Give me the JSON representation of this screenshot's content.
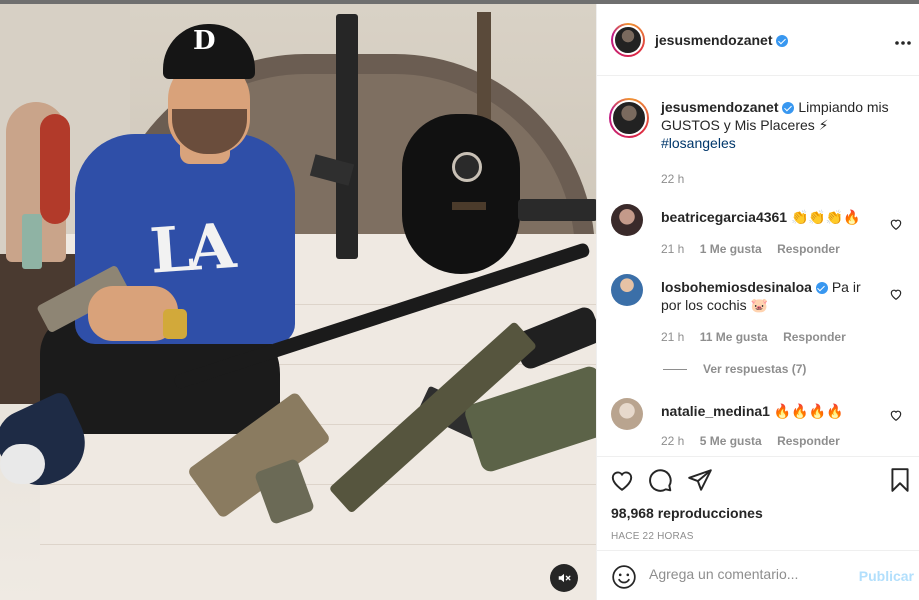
{
  "post": {
    "username": "jesusmendozanet",
    "more_icon": "more-horizontal-icon",
    "caption_text": "Limpiando mis GUSTOS y Mis Placeres ⚡",
    "hashtag": "#losangeles",
    "caption_time": "22 h",
    "media": {
      "mute_icon": "speaker-muted-icon",
      "cap_logo": "D",
      "shirt_logo": "LA"
    }
  },
  "comments": [
    {
      "username": "beatricegarcia4361",
      "text": "👏👏👏🔥",
      "verified": false,
      "time": "21 h",
      "likes": "1 Me gusta",
      "reply": "Responder"
    },
    {
      "username": "losbohemiosdesinaloa",
      "text": "Pa ir por los cochis 🐷",
      "verified": true,
      "time": "21 h",
      "likes": "11 Me gusta",
      "reply": "Responder"
    },
    {
      "username": "natalie_medina1",
      "text": "🔥🔥🔥🔥",
      "verified": false,
      "time": "22 h",
      "likes": "5 Me gusta",
      "reply": "Responder"
    }
  ],
  "view_replies": "Ver respuestas (7)",
  "actions": {
    "like_icon": "heart-icon",
    "comment_icon": "comment-icon",
    "share_icon": "paper-plane-icon",
    "save_icon": "bookmark-icon"
  },
  "views": "98,968 reproducciones",
  "posted_ago": "HACE 22 HORAS",
  "add_comment": {
    "emoji_icon": "emoji-smile-icon",
    "placeholder": "Agrega un comentario...",
    "publish": "Publicar"
  },
  "colors": {
    "link_blue": "#00376b",
    "verified_blue": "#3897f0",
    "publish_disabled": "#b2dffc",
    "muted_text": "#8e8e8e"
  }
}
